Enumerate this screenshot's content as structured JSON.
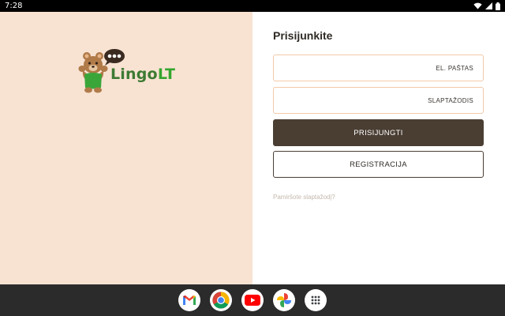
{
  "status_bar": {
    "time": "7:28",
    "icons": [
      "wifi-icon",
      "signal-icon",
      "battery-icon"
    ]
  },
  "logo": {
    "text_part1": "Lingo",
    "text_part2": "LT",
    "colors": {
      "green_dark": "#3d7a32",
      "green_light": "#35a52e",
      "bear": "#b07a49",
      "shirt": "#3aa63a"
    }
  },
  "login": {
    "title": "Prisijunkite",
    "email_placeholder": "EL. PAŠTAS",
    "password_placeholder": "SLAPTAŽODIS",
    "login_button": "PRISIJUNGTI",
    "register_button": "REGISTRACIJA",
    "forgot_link": "Pamiršote slaptažodį?"
  },
  "colors": {
    "left_panel_bg": "#f8e3d3",
    "primary_button": "#4a3e33",
    "field_border": "#f2c9a8",
    "taskbar": "#2b2b2b"
  },
  "taskbar": {
    "apps": [
      "gmail-icon",
      "chrome-icon",
      "youtube-icon",
      "photos-icon",
      "app-drawer-icon"
    ]
  }
}
